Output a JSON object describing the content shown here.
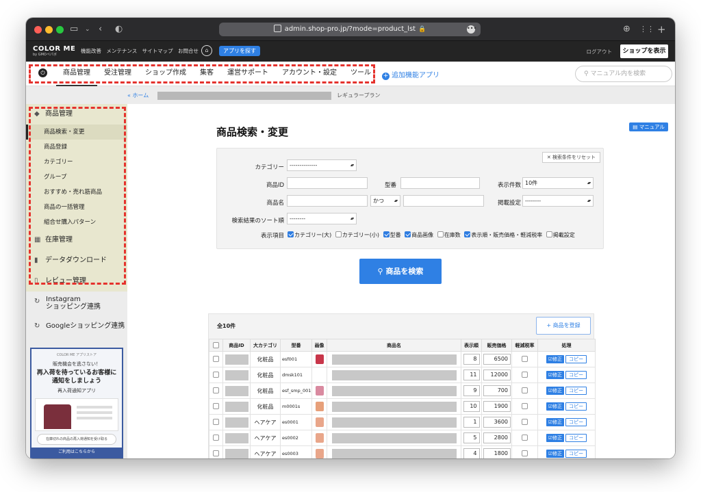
{
  "browser": {
    "url": "admin.shop-pro.jp/?mode=product_lst"
  },
  "app": {
    "logo": "COLOR ME",
    "logo_sub": "by GMOペパボ",
    "top_links": [
      "機能改善",
      "メンテナンス",
      "サイトマップ",
      "お問合せ"
    ],
    "app_search": "アプリを探す",
    "logout": "ログアウト",
    "view_shop": "ショップを表示"
  },
  "nav": {
    "items": [
      "商品管理",
      "受注管理",
      "ショップ作成",
      "集客",
      "運営サポート",
      "アカウント・設定",
      "ツール"
    ],
    "add_app": "追加機能アプリ",
    "manual_search_placeholder": "マニュアル内を検索"
  },
  "breadcrumb": {
    "home": "« ホーム",
    "plan": "レギュラープラン"
  },
  "sidebar": {
    "section_title": "商品管理",
    "sub_items": [
      "商品検索・変更",
      "商品登録",
      "カテゴリー",
      "グループ",
      "おすすめ・売れ筋商品",
      "商品の一括管理",
      "組合せ購入パターン"
    ],
    "others": [
      "在庫管理",
      "データダウンロード",
      "レビュー管理"
    ],
    "instagram": [
      "Instagram",
      "ショッピング連携"
    ],
    "google": "Googleショッピング連携",
    "banner": {
      "logo": "COLOR ME アプリストア",
      "line1": "販売機会を逃さない！",
      "line2a": "再入荷を待っているお客様に",
      "line2b": "通知をしましょう",
      "line3": "再入荷通知アプリ",
      "pill": "在庫切れの商品の再入荷通知を受け取る",
      "footer": "ご利用はこちらから"
    }
  },
  "main": {
    "manual": "マニュアル",
    "title": "商品検索・変更",
    "reset": "検索条件をリセット",
    "labels": {
      "category": "カテゴリー",
      "product_id": "商品ID",
      "model": "型番",
      "display_count": "表示件数",
      "product_name": "商品名",
      "listing": "掲載設定",
      "sort": "検索結果のソート順",
      "display_items": "表示項目"
    },
    "values": {
      "category": "--------------",
      "display_count": "10件",
      "and_or": "かつ",
      "listing": "--------",
      "sort": "--------"
    },
    "columns": [
      {
        "label": "カテゴリー(大)",
        "checked": true
      },
      {
        "label": "カテゴリー(小)",
        "checked": false
      },
      {
        "label": "型番",
        "checked": true
      },
      {
        "label": "商品画像",
        "checked": true
      },
      {
        "label": "在庫数",
        "checked": false
      },
      {
        "label": "表示順・販売価格・軽減税率",
        "checked": true
      },
      {
        "label": "掲載設定",
        "checked": false
      }
    ],
    "search_button": "商品を検索"
  },
  "results": {
    "count": "全10件",
    "register": "+ 商品を登録",
    "headers": [
      "商品ID",
      "大カテゴリ",
      "型番",
      "画像",
      "商品名",
      "表示順",
      "販売価格",
      "軽減税率",
      "処理"
    ],
    "edit": "修正",
    "copy": "コピー",
    "rows": [
      {
        "cat": "化粧品",
        "code": "esf001",
        "order": "8",
        "price": "6500",
        "thumb": "#c8364a"
      },
      {
        "cat": "化粧品",
        "code": "dmsk101",
        "order": "11",
        "price": "12000",
        "thumb": ""
      },
      {
        "cat": "化粧品",
        "code": "esf_smp_001",
        "order": "9",
        "price": "700",
        "thumb": "#d98aa0"
      },
      {
        "cat": "化粧品",
        "code": "m0001s",
        "order": "10",
        "price": "1900",
        "thumb": "#e7a07a"
      },
      {
        "cat": "ヘアケア",
        "code": "es0001",
        "order": "1",
        "price": "3600",
        "thumb": "#e9a68a"
      },
      {
        "cat": "ヘアケア",
        "code": "es0002",
        "order": "5",
        "price": "2800",
        "thumb": "#e9a68a"
      },
      {
        "cat": "ヘアケア",
        "code": "es0003",
        "order": "4",
        "price": "1800",
        "thumb": "#e9a68a"
      }
    ]
  }
}
